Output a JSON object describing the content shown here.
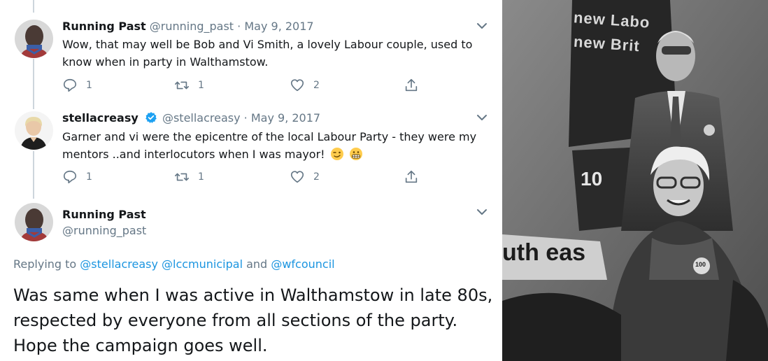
{
  "tweets": [
    {
      "name": "Running Past",
      "handle": "@running_past",
      "separator": "·",
      "date": "May 9, 2017",
      "text": "Wow, that may well be Bob and Vi Smith, a lovely Labour couple, used to know when in party in Walthamstow.",
      "replies": "1",
      "retweets": "1",
      "likes": "2"
    },
    {
      "name": "stellacreasy",
      "handle": "@stellacreasy",
      "separator": "·",
      "date": "May 9, 2017",
      "text": "Garner and vi were the epicentre of the local Labour Party - they were my mentors ..and interlocutors when I was mayor!",
      "replies": "1",
      "retweets": "1",
      "likes": "2"
    }
  ],
  "main_tweet": {
    "name": "Running Past",
    "handle": "@running_past",
    "replying_prefix": "Replying to",
    "mention_1": "@stellacreasy",
    "mention_2": "@lccmunicipal",
    "and_word": "and",
    "mention_3": "@wfcouncil",
    "text": "Was same when I was active in Walthamstow in late 80s, respected by everyone from all sections of the party. Hope the campaign goes well."
  },
  "photo": {
    "sign_line_1": "new Labo",
    "sign_line_2": "new Brit",
    "sign_number": "10",
    "banner_text": "uth eas",
    "badge_text": "100"
  },
  "icons": [
    "reply-icon",
    "retweet-icon",
    "like-icon",
    "share-icon",
    "chevron-down-icon",
    "verified-badge-icon",
    "winking-face-icon",
    "grimacing-face-icon"
  ],
  "colors": {
    "text_primary": "#14171a",
    "text_secondary": "#657786",
    "link": "#1b95e0",
    "verified": "#1da1f2",
    "thread_line": "#cdd5dc"
  }
}
